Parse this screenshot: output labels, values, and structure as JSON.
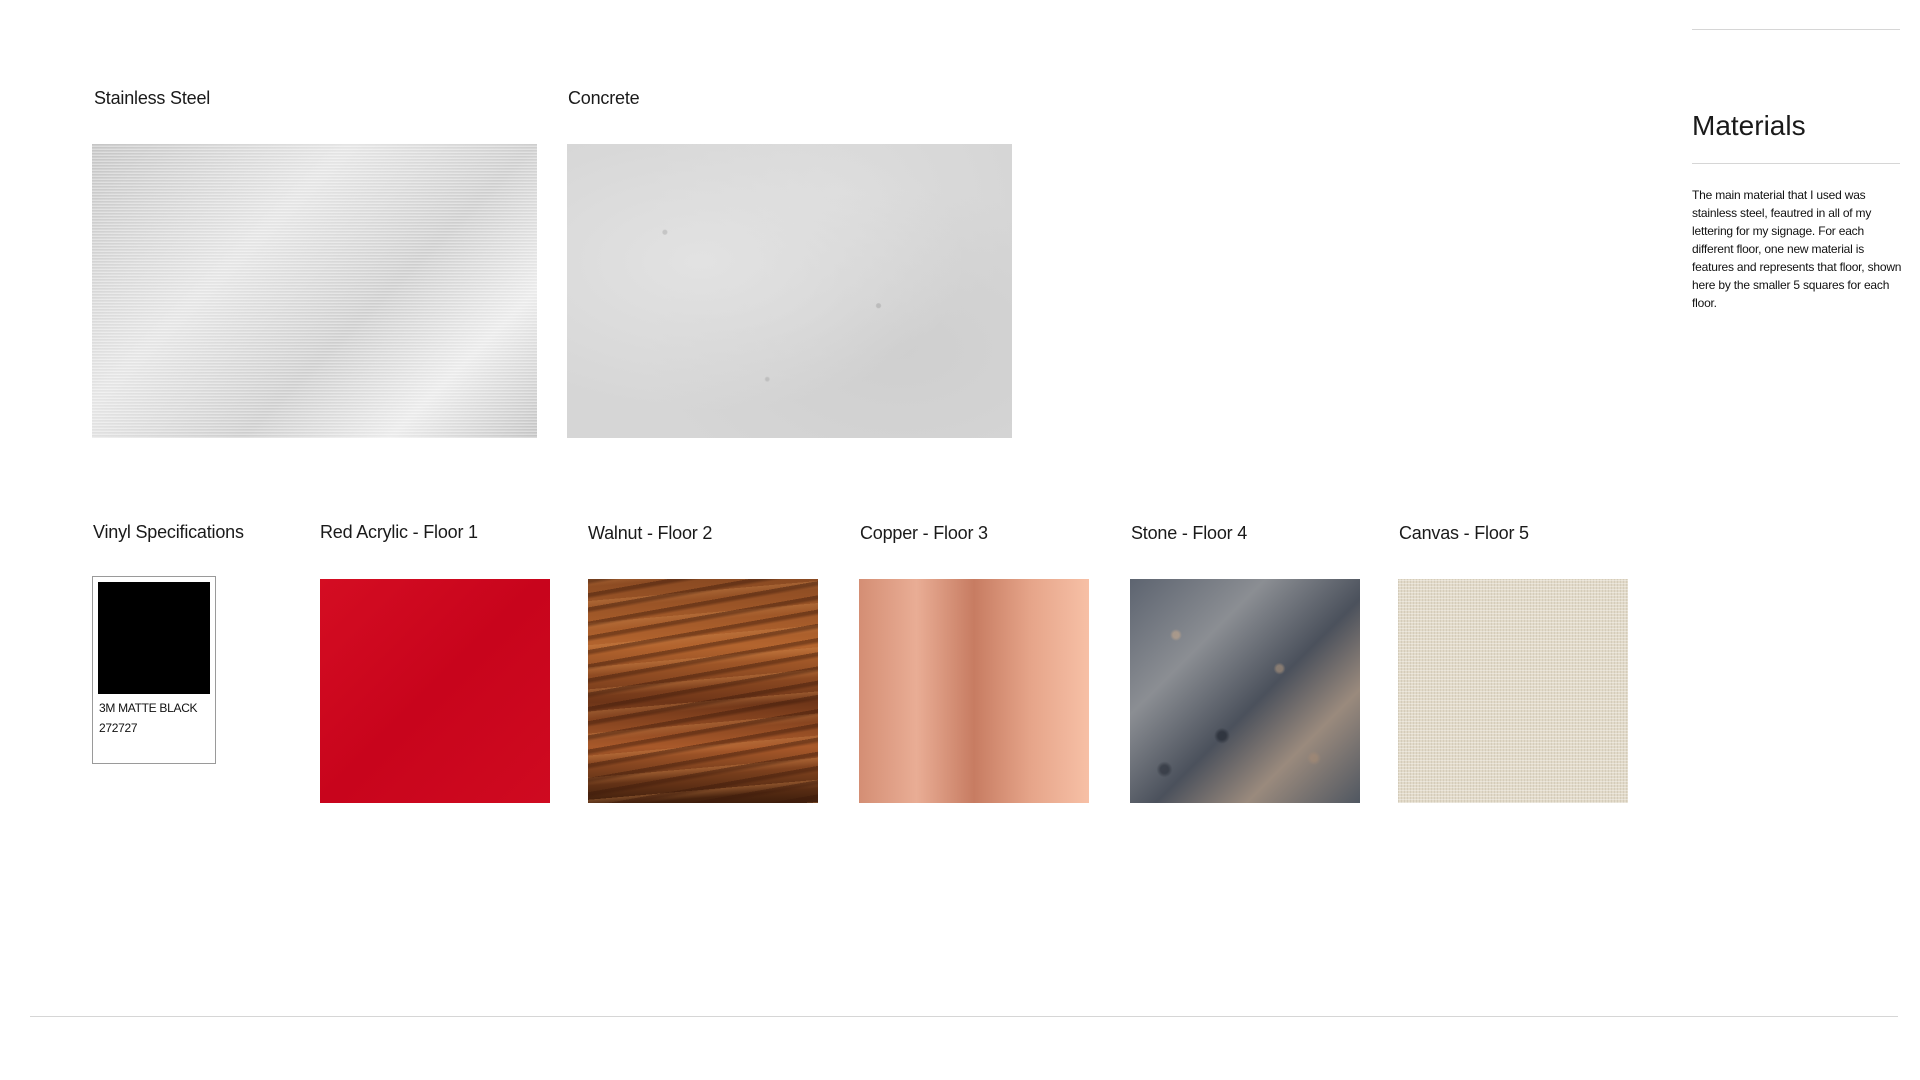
{
  "materials": {
    "stainless_steel_label": "Stainless Steel",
    "concrete_label": "Concrete"
  },
  "floors": {
    "vinyl_label": "Vinyl Specifications",
    "red_acrylic_label": "Red Acrylic  -  Floor 1",
    "walnut_label": "Walnut  -  Floor 2",
    "copper_label": "Copper  -  Floor 3",
    "stone_label": "Stone  -  Floor 4",
    "canvas_label": "Canvas  -  Floor 5"
  },
  "vinyl": {
    "name": "3M MATTE BLACK",
    "code": "272727",
    "color": "#000000"
  },
  "sidebar": {
    "title": "Materials",
    "description": "The main material that I used was stainless steel, feautred in all of my lettering for my signage. For each different floor, one new material is features and represents that floor, shown here by the smaller 5 squares for each floor."
  },
  "colors": {
    "red_acrylic": "#c8041c",
    "rule": "#d6d6d6"
  }
}
